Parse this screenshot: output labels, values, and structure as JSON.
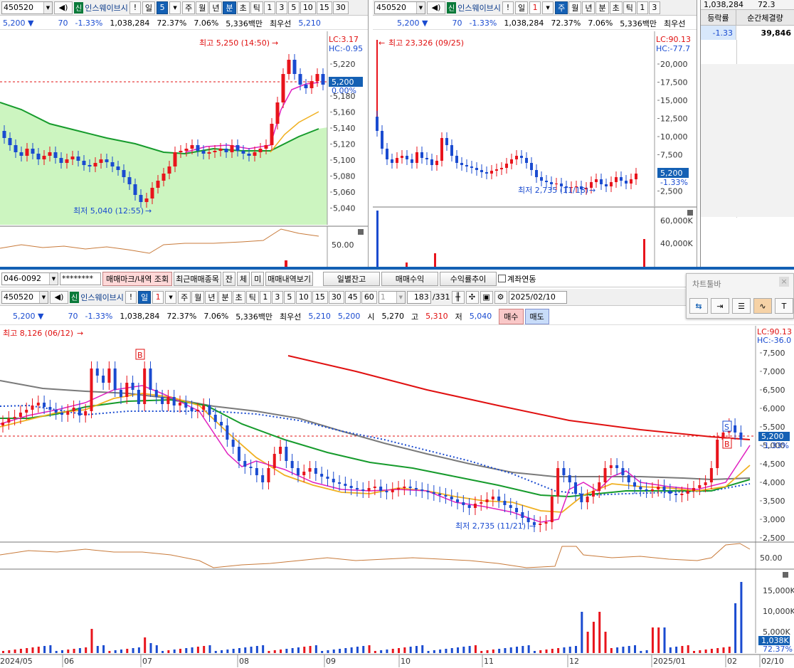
{
  "top_left": {
    "code": "450520",
    "pill": "신",
    "name": "인스웨이브시",
    "excl": "!",
    "period_label": "일",
    "period_num": "5",
    "buttons": [
      "주",
      "월",
      "년",
      "분",
      "초",
      "틱",
      "1",
      "3",
      "5",
      "10",
      "15",
      "30"
    ],
    "selected_button": "분",
    "info": {
      "price": "5,200",
      "arrow": "▼",
      "change": "70",
      "rate": "-1.33%",
      "volume": "1,038,284",
      "ratio": "72.37%",
      "turn": "7.06%",
      "amount": "5,336백만",
      "best_label": "최우선",
      "best": "5,210"
    },
    "price_axis": [
      "5,220",
      "5,200",
      "5,180",
      "5,160",
      "5,140",
      "5,120",
      "5,100",
      "5,080",
      "5,060",
      "5,040"
    ],
    "lc": "LC:3.17",
    "hc": "HC:-0.95",
    "cur_price": "5,200",
    "cur_rate": "0.00%",
    "high_label": "최고 5,250 (14:50)",
    "low_label": "최저 5,040 (12:55)",
    "osc_label": "50.00"
  },
  "top_mid": {
    "code": "450520",
    "pill": "신",
    "name": "인스웨이브시",
    "excl": "!",
    "period_label": "일",
    "period_num": "1",
    "buttons": [
      "주",
      "월",
      "년",
      "분",
      "초",
      "틱",
      "1",
      "3"
    ],
    "selected_button": "주",
    "info": {
      "price": "5,200",
      "arrow": "▼",
      "change": "70",
      "rate": "-1.33%",
      "volume": "1,038,284",
      "ratio": "72.37%",
      "turn": "7.06%",
      "amount": "5,336백만",
      "best_label": "최우선"
    },
    "price_axis": [
      "20,000",
      "17,500",
      "15,000",
      "12,500",
      "10,000",
      "7,500",
      "5,000",
      "2,500"
    ],
    "lc": "LC:90.13",
    "hc": "HC:-77.7",
    "cur_price": "5,200",
    "cur_rate": "-1.33%",
    "high_label": "최고 23,326 (09/25)",
    "low_label": "최저 2,735 (11/18)",
    "vol_axis": [
      "60,000K",
      "40,000K"
    ]
  },
  "right_panel": {
    "volume": "1,038,284",
    "ratio": "72.3",
    "header": [
      "등락률",
      "순간체결량"
    ],
    "row": [
      "-1.33",
      "39,846"
    ]
  },
  "bottom": {
    "account": "046-0092",
    "password": "********",
    "btn_mark": "매매마크/내역 조회",
    "btn_recent": "최근매매종목",
    "btn_jan": "잔",
    "btn_che": "체",
    "btn_mi": "미",
    "btn_history": "매매내역보기",
    "btn_daily": "일별잔고",
    "btn_profit": "매매수익",
    "btn_trend": "수익률추이",
    "chk_link": "계좌연동",
    "code": "450520",
    "pill": "신",
    "name": "인스웨이브시",
    "excl": "!",
    "period_label": "일",
    "period_num": "1",
    "buttons": [
      "주",
      "월",
      "년",
      "분",
      "초",
      "틱",
      "1",
      "3",
      "5",
      "10",
      "15",
      "30",
      "45",
      "60"
    ],
    "selected_button": "일",
    "last_combo": "1",
    "page": "183",
    "page_total": "/331",
    "date": "2025/02/10",
    "info": {
      "price": "5,200",
      "arrow": "▼",
      "change": "70",
      "rate": "-1.33%",
      "volume": "1,038,284",
      "ratio": "72.37%",
      "turn": "7.06%",
      "amount": "5,336백만",
      "best_label": "최우선",
      "best1": "5,210",
      "best2": "5,200",
      "open_label": "시",
      "open": "5,270",
      "high_label": "고",
      "high": "5,310",
      "low_label": "저",
      "low": "5,040"
    },
    "buy": "매수",
    "sell": "매도",
    "price_axis": [
      "7,500",
      "7,000",
      "6,500",
      "6,000",
      "5,500",
      "5,000",
      "4,500",
      "4,000",
      "3,500",
      "3,000",
      "2,500"
    ],
    "lc": "LC:90.13",
    "hc": "HC:-36.0",
    "cur_price": "5,200",
    "cur_rate": "-1.33%",
    "high_label": "최고 8,126 (06/12)",
    "low_label": "최저 2,735 (11/21)",
    "osc_label": "50.00",
    "vol_axis": [
      "15,000K",
      "10,000K",
      "5,000K"
    ],
    "vol_cur": "1,038K",
    "vol_rate": "72.37%",
    "x_axis": [
      "2024/05",
      "06",
      "07",
      "08",
      "09",
      "10",
      "11",
      "12",
      "2025/01",
      "02",
      "02/10"
    ],
    "mark_b": "B",
    "mark_s": "S"
  },
  "toolbar_popup": {
    "title": "차트툴바",
    "close": "×"
  },
  "colors": {
    "up": "#e8141c",
    "down": "#1a4bd0",
    "ma_green": "#169b2c",
    "ma_gray": "#7a7a7a",
    "ma_red": "#e01010",
    "ma_pink": "#e020c0",
    "ma_orange": "#f0b020",
    "area_fill": "#ccf5c0",
    "sel_blue": "#1460b4"
  }
}
